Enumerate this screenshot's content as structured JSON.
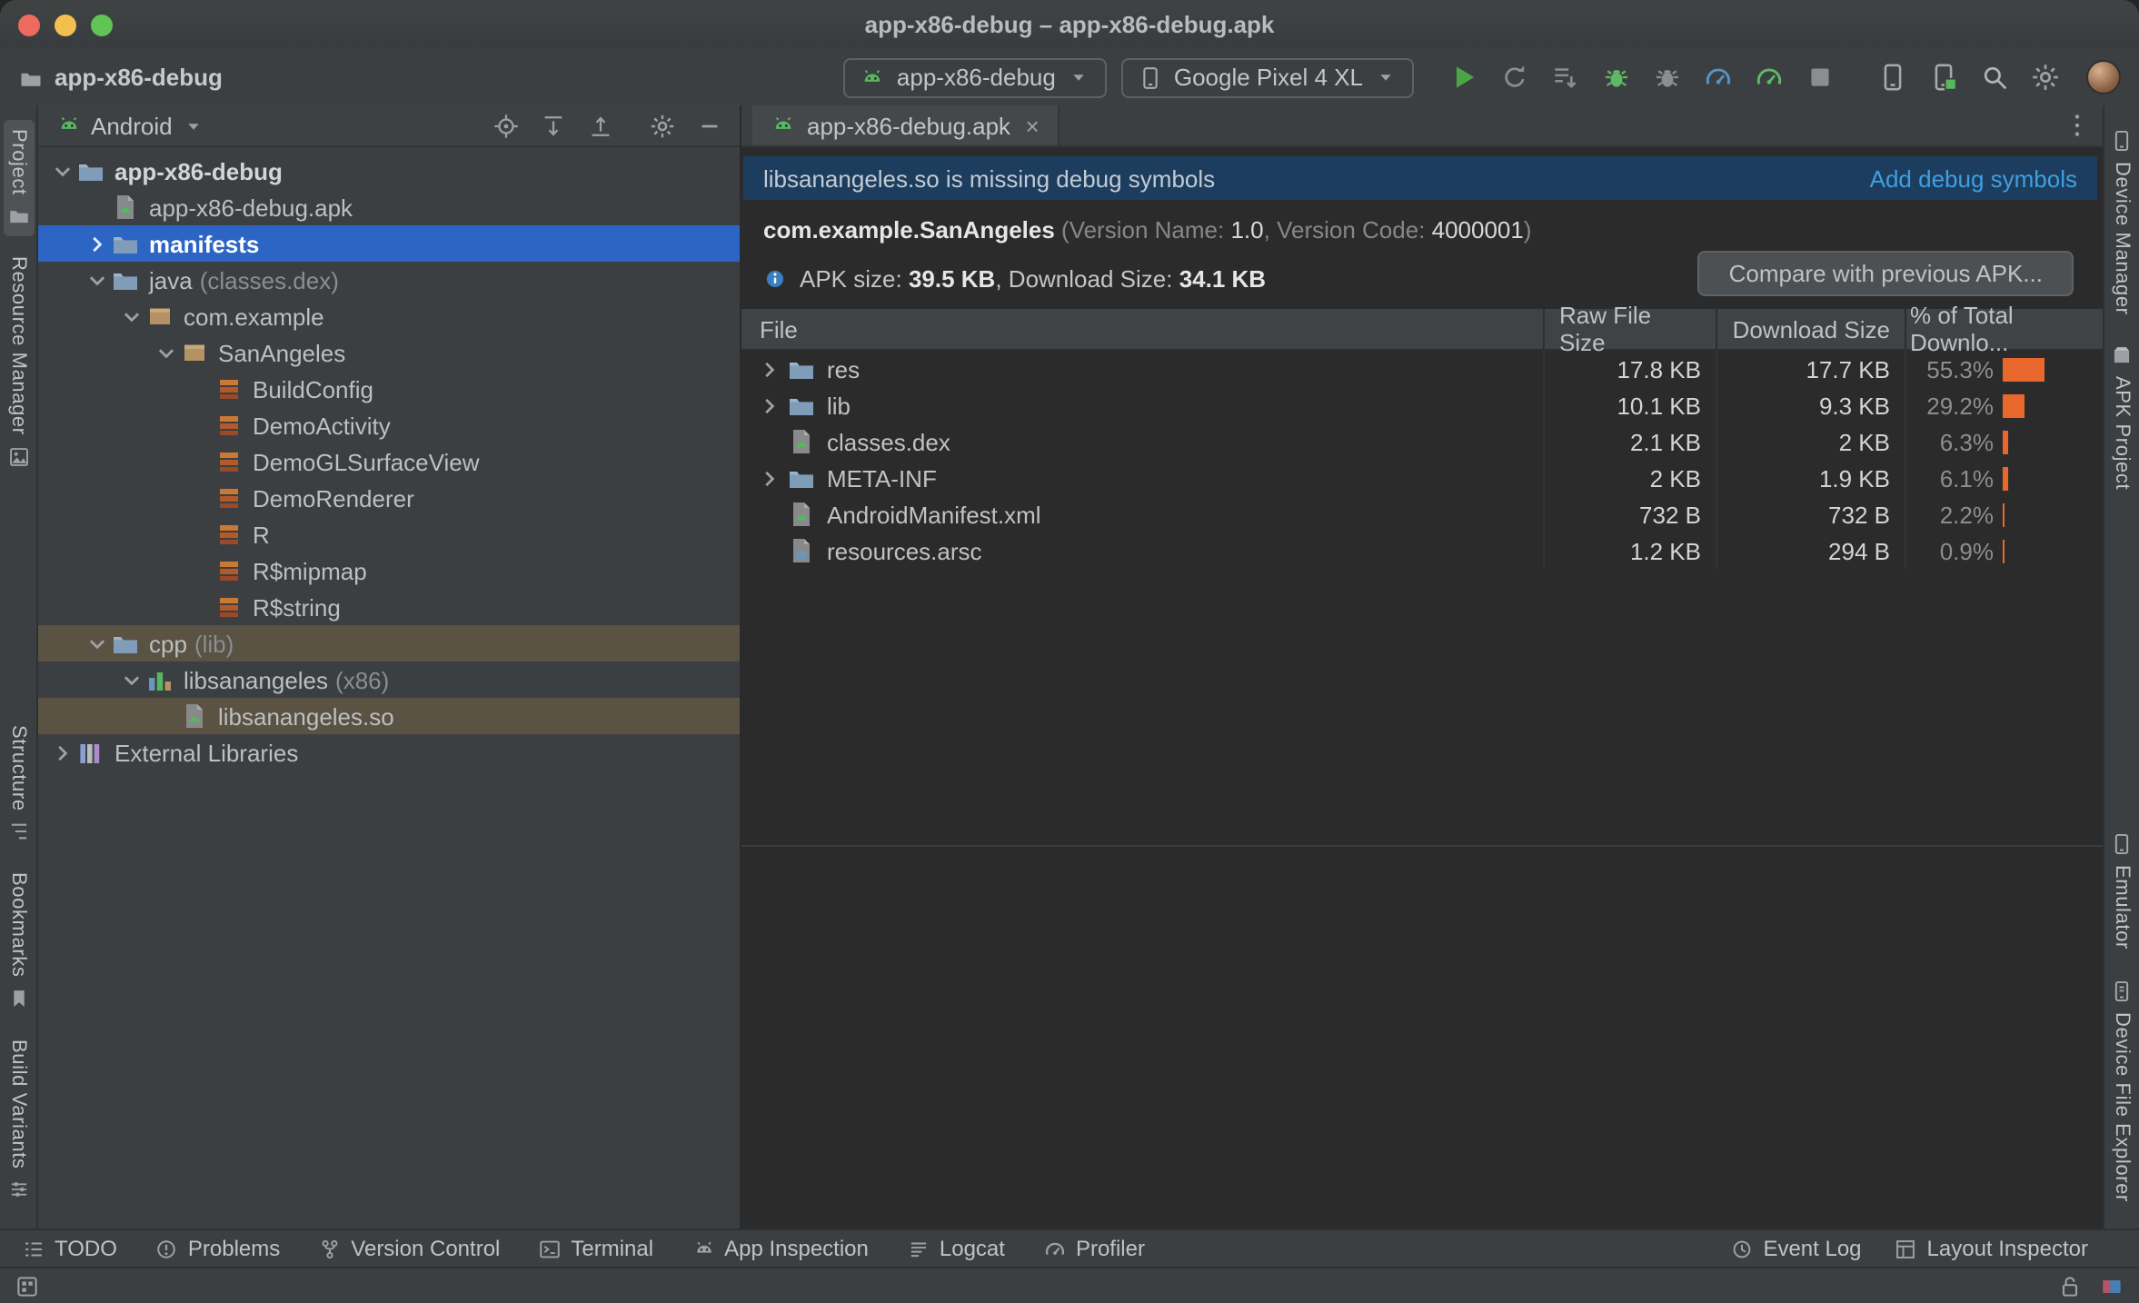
{
  "window": {
    "title": "app-x86-debug – app-x86-debug.apk"
  },
  "toolbar": {
    "project_name": "app-x86-debug",
    "run_config_label": "app-x86-debug",
    "device_label": "Google Pixel 4 XL",
    "actions": [
      "run",
      "apply-changes",
      "apply-code-changes",
      "debug",
      "attach-debugger",
      "profile",
      "profile-low-overhead",
      "stop",
      "device-manager",
      "avd-manager",
      "search-everywhere",
      "settings",
      "user-avatar"
    ]
  },
  "left_stripe": {
    "top": [
      {
        "label": "Project",
        "icon": "project",
        "active": true
      },
      {
        "label": "Resource Manager",
        "icon": "resource-manager"
      }
    ],
    "bottom": [
      {
        "label": "Structure",
        "icon": "structure"
      },
      {
        "label": "Bookmarks",
        "icon": "bookmarks"
      },
      {
        "label": "Build Variants",
        "icon": "build-variants"
      }
    ]
  },
  "right_stripe": {
    "top": [
      {
        "label": "Device Manager",
        "icon": "device-manager"
      },
      {
        "label": "APK Project",
        "icon": "apk-project"
      }
    ],
    "bottom": [
      {
        "label": "Emulator",
        "icon": "emulator"
      },
      {
        "label": "Device File Explorer",
        "icon": "device-file-explorer"
      }
    ]
  },
  "project_panel": {
    "view_selector": "Android",
    "header_actions": [
      "locate-file",
      "expand-all",
      "collapse-all",
      "settings",
      "hide-panel"
    ],
    "tree": [
      {
        "level": 0,
        "chevron": "down",
        "icon": "folder",
        "label": "app-x86-debug",
        "bold": true
      },
      {
        "level": 1,
        "icon": "apk-file",
        "label": "app-x86-debug.apk"
      },
      {
        "level": 1,
        "chevron": "right",
        "icon": "folder",
        "label": "manifests",
        "bold": true,
        "selected": "blue"
      },
      {
        "level": 1,
        "chevron": "down",
        "icon": "folder",
        "label": "java",
        "suffix": "(classes.dex)"
      },
      {
        "level": 2,
        "chevron": "down",
        "icon": "package",
        "label": "com.example"
      },
      {
        "level": 3,
        "chevron": "down",
        "icon": "package",
        "label": "SanAngeles"
      },
      {
        "level": 4,
        "icon": "class",
        "label": "BuildConfig"
      },
      {
        "level": 4,
        "icon": "class",
        "label": "DemoActivity"
      },
      {
        "level": 4,
        "icon": "class",
        "label": "DemoGLSurfaceView"
      },
      {
        "level": 4,
        "icon": "class",
        "label": "DemoRenderer"
      },
      {
        "level": 4,
        "icon": "class",
        "label": "R"
      },
      {
        "level": 4,
        "icon": "class",
        "label": "R$mipmap"
      },
      {
        "level": 4,
        "icon": "class",
        "label": "R$string"
      },
      {
        "level": 1,
        "chevron": "down",
        "icon": "folder",
        "label": "cpp",
        "suffix": "(lib)",
        "selected": "brown"
      },
      {
        "level": 2,
        "chevron": "down",
        "icon": "native-lib",
        "label": "libsanangeles",
        "suffix": "(x86)"
      },
      {
        "level": 3,
        "icon": "so-file",
        "label": "libsanangeles.so",
        "selected": "brown"
      },
      {
        "level": 0,
        "chevron": "right",
        "icon": "external-lib",
        "label": "External Libraries"
      }
    ]
  },
  "editor": {
    "tab_label": "app-x86-debug.apk"
  },
  "apk_analyzer": {
    "banner": {
      "message": "libsanangeles.so is missing debug symbols",
      "action": "Add debug symbols"
    },
    "package_line": [
      {
        "text": "com.example.SanAngeles",
        "style": "bold"
      },
      {
        "text": " (Version Name: ",
        "style": "dim"
      },
      {
        "text": "1.0",
        "style": "normal"
      },
      {
        "text": ", Version Code: ",
        "style": "dim"
      },
      {
        "text": "4000001",
        "style": "normal"
      },
      {
        "text": ")",
        "style": "dim"
      }
    ],
    "size_line": [
      {
        "text": "APK size: ",
        "style": "normal"
      },
      {
        "text": "39.5 KB",
        "style": "bold"
      },
      {
        "text": ", Download Size: ",
        "style": "normal"
      },
      {
        "text": "34.1 KB",
        "style": "bold"
      }
    ],
    "compare_button": "Compare with previous APK...",
    "table": {
      "columns": [
        "File",
        "Raw File Size",
        "Download Size",
        "% of Total Downlo..."
      ],
      "rows": [
        {
          "name": "res",
          "icon": "folder",
          "expandable": true,
          "raw": "17.8 KB",
          "download": "17.7 KB",
          "percent": "55.3%",
          "percent_value": 55.3
        },
        {
          "name": "lib",
          "icon": "folder",
          "expandable": true,
          "raw": "10.1 KB",
          "download": "9.3 KB",
          "percent": "29.2%",
          "percent_value": 29.2
        },
        {
          "name": "classes.dex",
          "icon": "dex-file",
          "expandable": false,
          "raw": "2.1 KB",
          "download": "2 KB",
          "percent": "6.3%",
          "percent_value": 6.3
        },
        {
          "name": "META-INF",
          "icon": "folder",
          "expandable": true,
          "raw": "2 KB",
          "download": "1.9 KB",
          "percent": "6.1%",
          "percent_value": 6.1
        },
        {
          "name": "AndroidManifest.xml",
          "icon": "xml-file",
          "expandable": false,
          "raw": "732 B",
          "download": "732 B",
          "percent": "2.2%",
          "percent_value": 2.2
        },
        {
          "name": "resources.arsc",
          "icon": "arsc-file",
          "expandable": false,
          "raw": "1.2 KB",
          "download": "294 B",
          "percent": "0.9%",
          "percent_value": 0.9
        }
      ]
    }
  },
  "bottom_bar": {
    "left": [
      {
        "label": "TODO",
        "icon": "todo"
      },
      {
        "label": "Problems",
        "icon": "problems"
      },
      {
        "label": "Version Control",
        "icon": "version-control"
      },
      {
        "label": "Terminal",
        "icon": "terminal"
      },
      {
        "label": "App Inspection",
        "icon": "app-inspection"
      },
      {
        "label": "Logcat",
        "icon": "logcat"
      },
      {
        "label": "Profiler",
        "icon": "profiler"
      }
    ],
    "right": [
      {
        "label": "Event Log",
        "icon": "event-log"
      },
      {
        "label": "Layout Inspector",
        "icon": "layout-inspector"
      }
    ]
  },
  "status_bar": {
    "icons_left": [
      "tool-window-switcher"
    ],
    "icons_right": [
      "unlock",
      "memory-indicator"
    ]
  },
  "colors": {
    "selection_blue": "#2d65c4",
    "selection_brown": "#5a5242",
    "bar_orange": "#e8672c",
    "link_blue": "#3f9fe0",
    "banner_bg": "#1d3d5f",
    "android_green": "#57b75f"
  }
}
